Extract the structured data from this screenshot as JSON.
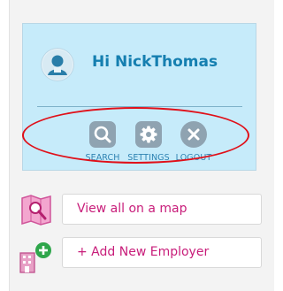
{
  "user": {
    "greeting": "Hi NickThomas"
  },
  "actions": [
    {
      "label": "SEARCH",
      "icon": "search-icon"
    },
    {
      "label": "SETTINGS",
      "icon": "gear-icon"
    },
    {
      "label": "LOGOUT",
      "icon": "close-icon"
    }
  ],
  "links": {
    "map_label": "View all on a map",
    "add_employer_label": "+ Add New Employer"
  },
  "colors": {
    "card_background": "#c6ebfa",
    "greeting": "#157fb0",
    "link_text": "#c81d7a",
    "highlight_ring": "#e01019"
  }
}
